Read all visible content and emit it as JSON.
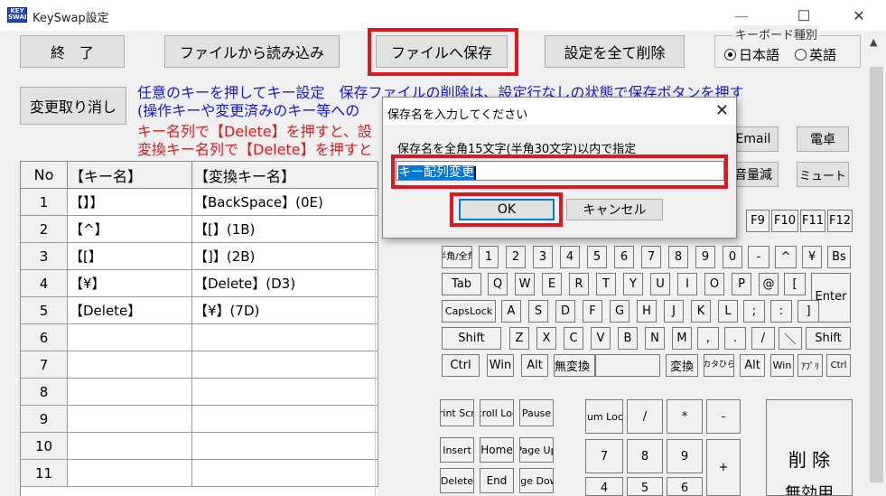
{
  "window": {
    "title": "KeySwap設定",
    "icon_text": "KEY SWAP",
    "min_icon": "minimize-icon",
    "max_icon": "maximize-icon",
    "close_icon": "close-icon",
    "min_glyph": "—",
    "max_glyph": "☐",
    "close_glyph": "✕"
  },
  "toolbar": {
    "exit_label": "終　了",
    "load_label": "ファイルから読み込み",
    "save_label": "ファイルへ保存",
    "delete_all_label": "設定を全て削除",
    "undo_label": "変更取り消し"
  },
  "language": {
    "legend": "キーボード種別",
    "options": [
      "日本語",
      "英語"
    ],
    "selected": "日本語"
  },
  "instructions": {
    "blue_line1": "任意のキーを押してキー設定　保存ファイルの削除は、設定行なしの状態で保存ボタンを押す",
    "blue_line2": "(操作キーや変更済みのキー等への",
    "red_line1": "キー名列で【Delete】を押すと、設",
    "red_line2": "変換キー名列で【Delete】を押すと"
  },
  "grid": {
    "columns": [
      "No",
      "【キー名】",
      "【変換キー名】"
    ],
    "rows": [
      {
        "no": "1",
        "key": "【】】",
        "mapped": "【BackSpace】(0E)"
      },
      {
        "no": "2",
        "key": "【^】",
        "mapped": "【[】(1B)"
      },
      {
        "no": "3",
        "key": "【[】",
        "mapped": "【]】(2B)"
      },
      {
        "no": "4",
        "key": "【¥】",
        "mapped": "【Delete】(D3)"
      },
      {
        "no": "5",
        "key": "【Delete】",
        "mapped": "【¥】(7D)"
      },
      {
        "no": "6",
        "key": "",
        "mapped": ""
      },
      {
        "no": "7",
        "key": "",
        "mapped": ""
      },
      {
        "no": "8",
        "key": "",
        "mapped": ""
      },
      {
        "no": "9",
        "key": "",
        "mapped": ""
      },
      {
        "no": "10",
        "key": "",
        "mapped": ""
      },
      {
        "no": "11",
        "key": "",
        "mapped": ""
      }
    ]
  },
  "side_buttons": {
    "email": "Email",
    "calculator": "電卓",
    "volume": "音量減",
    "mute": "ミュート"
  },
  "keyboard": {
    "fkeys": [
      "F9",
      "F10",
      "F11",
      "F12"
    ],
    "row1": [
      "半角/全角",
      "1",
      "2",
      "3",
      "4",
      "5",
      "6",
      "7",
      "8",
      "9",
      "0",
      "-",
      "^",
      "¥",
      "Bs"
    ],
    "row2": [
      "Tab",
      "Q",
      "W",
      "E",
      "R",
      "T",
      "Y",
      "U",
      "I",
      "O",
      "P",
      "@",
      "[",
      "Enter"
    ],
    "row3": [
      "CapsLock",
      "A",
      "S",
      "D",
      "F",
      "G",
      "H",
      "J",
      "K",
      "L",
      ";",
      ":",
      "]"
    ],
    "row4": [
      "Shift",
      "Z",
      "X",
      "C",
      "V",
      "B",
      "N",
      "M",
      ",",
      ".",
      "/",
      "＼",
      "Shift"
    ],
    "row5": [
      "Ctrl",
      "Win",
      "Alt",
      "無変換",
      "",
      "変換",
      "カタひら",
      "Alt",
      "Win",
      "ｱﾌﾟﾘ",
      "Ctrl"
    ],
    "nav": [
      "Print Scrn",
      "Scroll Lock",
      "Pause",
      "Insert",
      "Home",
      "Page Up",
      "Delete",
      "End",
      "Page Down"
    ],
    "numpad": [
      "Num Lock",
      "/",
      "*",
      "-",
      "7",
      "8",
      "9",
      "+",
      "4",
      "5",
      "6"
    ],
    "delete_label": "削 除",
    "disable_label": "無効用"
  },
  "dialog": {
    "title": "保存名を入力してください",
    "label": "保存名を全角15文字(半角30文字)以内で指定",
    "input_value": "キー配列変更",
    "ok_label": "OK",
    "cancel_label": "キャンセル",
    "close_glyph": "✕"
  },
  "colors": {
    "highlight_red": "#e2161e",
    "instruction_blue": "#1515e0",
    "selection_blue": "#0078d7"
  }
}
